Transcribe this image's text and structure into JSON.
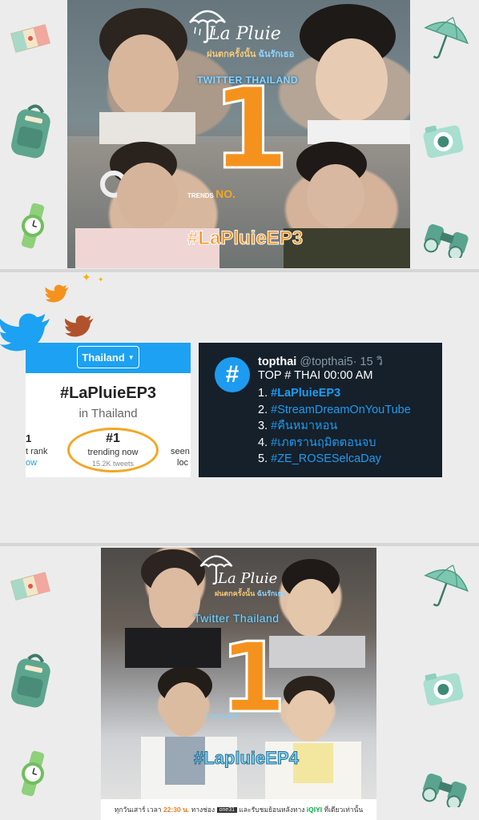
{
  "poster_top": {
    "logo": "La Pluie",
    "logo_thai": "ฝนตกครั้งนั้น",
    "logo_thai2": "ฉันรักเธอ",
    "twitter_region": "TWITTER THAILAND",
    "rank": "1",
    "trends_label": "TRENDS",
    "no_label": "NO.",
    "hashtag": "#LaPluieEP3"
  },
  "trend_card": {
    "country": "Thailand",
    "hashtag": "#LaPluieEP3",
    "location": "in Thailand",
    "left_value": "1",
    "left_label": "t rank",
    "left_sub": "ow",
    "rank": "#1",
    "rank_label": "trending now",
    "tweets": "15.2K tweets",
    "right_label": "seen",
    "right_sub": "loc"
  },
  "topthai": {
    "name": "topthai",
    "handle": "@topthai5",
    "time": "· 15 วิ",
    "title": "TOP # THAI 00:00 AM",
    "items": [
      {
        "num": "1.",
        "tag": "#LaPluieEP3"
      },
      {
        "num": "2.",
        "tag": "#StreamDreamOnYouTube"
      },
      {
        "num": "3.",
        "tag": "#คืนหมาหอน"
      },
      {
        "num": "4.",
        "tag": "#เภตรานฤมิตตอนจบ"
      },
      {
        "num": "5.",
        "tag": "#ZE_ROSESelcaDay"
      }
    ]
  },
  "poster_bottom": {
    "logo": "La Pluie",
    "logo_thai": "ฝนตกครั้งนั้น",
    "logo_thai2": "ฉันรักเธอ",
    "twitter_region": "Twitter Thailand",
    "rank": "1",
    "trends_label": "Trends NO.",
    "hashtag": "#LapluieEP4",
    "schedule_a": "ทุกวันเสาร์ เวลา",
    "schedule_time": "22:30 น.",
    "schedule_b": "ทางช่อง",
    "schedule_c": "และรับชมย้อนหลังทาง",
    "platform": "iQIYI",
    "schedule_d": "ที่เดียวเท่านั้น"
  },
  "colors": {
    "orange": "#f5921e",
    "twitter_blue": "#1da1f2",
    "dark_card": "#15202b"
  },
  "icons": [
    "map-icon",
    "backpack-icon",
    "watch-icon",
    "umbrella-icon",
    "camera-icon",
    "binoculars-icon",
    "twitter-bird-icon"
  ]
}
